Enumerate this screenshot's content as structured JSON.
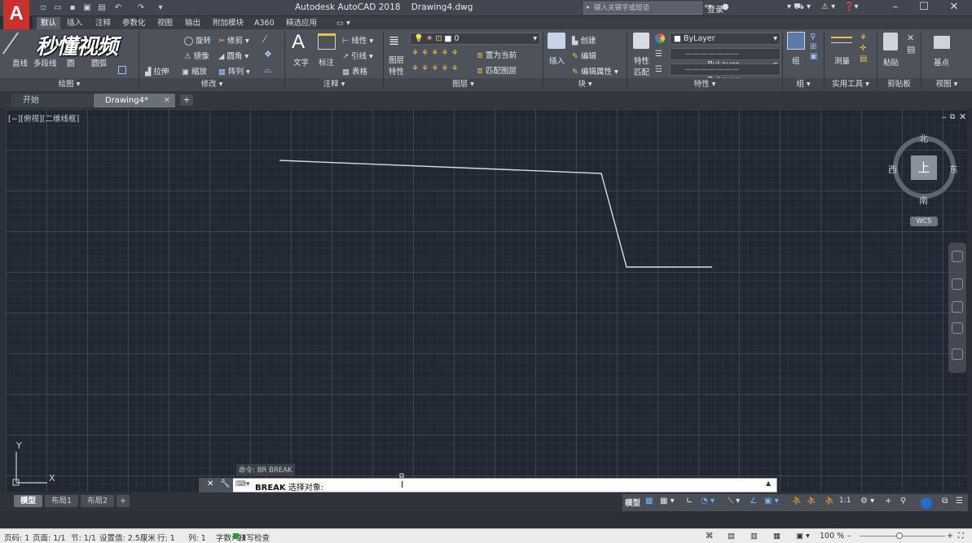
{
  "title": {
    "app": "Autodesk AutoCAD 2018",
    "doc": "Drawing4.dwg"
  },
  "search": {
    "placeholder": "键入关键字或短语"
  },
  "signin": "登录",
  "menu_tabs": [
    "默认",
    "插入",
    "注释",
    "参数化",
    "视图",
    "输出",
    "附加模块",
    "A360",
    "精选应用"
  ],
  "ribbon": {
    "draw": {
      "line": "直线",
      "polyline": "多段线",
      "circle": "圆",
      "arc": "圆弧"
    },
    "modify": {
      "rotate": "旋转",
      "trim": "修剪",
      "mirror": "镜像",
      "fillet": "圆角",
      "stretch": "拉伸",
      "scale": "缩放",
      "array": "阵列"
    },
    "annotation": {
      "text": "文字",
      "dimension": "标注",
      "linear": "线性",
      "leader": "引线",
      "table": "表格"
    },
    "layers": {
      "layer_props_1": "图层",
      "layer_props_2": "特性",
      "layer_value": "0",
      "set_current": "置为当前",
      "match_layer": "匹配图层"
    },
    "block": {
      "insert": "插入",
      "create": "创建",
      "edit": "编辑",
      "edit_attr": "编辑属性"
    },
    "properties": {
      "match_1": "特性",
      "match_2": "匹配",
      "color": "ByLayer",
      "linetype": "ByLayer",
      "lineweight": "ByLayer"
    },
    "groups": {
      "group": "组"
    },
    "utilities": {
      "measure": "测量"
    },
    "clipboard": {
      "paste": "粘贴"
    },
    "view": {
      "base": "基点"
    }
  },
  "panels": [
    "绘图 ▾",
    "修改 ▾",
    "注释 ▾",
    "图层 ▾",
    "块 ▾",
    "特性 ▾",
    "组 ▾",
    "实用工具 ▾",
    "剪贴板",
    "视图 ▾"
  ],
  "doc_tabs": [
    "开始",
    "Drawing4*"
  ],
  "viewport": {
    "label": "[−][俯视][二维线框]",
    "ucs_x": "X",
    "ucs_y": "Y"
  },
  "viewcube": {
    "north": "北",
    "south": "南",
    "east": "东",
    "west": "西",
    "top": "上",
    "wcs": "WCS"
  },
  "command": {
    "history": "命令: BR BREAK",
    "name": "BREAK",
    "prompt": "选择对象:"
  },
  "layout_tabs": [
    "模型",
    "布局1",
    "布局2"
  ],
  "status": {
    "model": "模型",
    "scale": "1:1"
  },
  "wordbar": {
    "page": "页码: 1",
    "pages": "页面: 1/1",
    "section": "节: 1/1",
    "setting": "设置值: 2.5厘米",
    "row": "行: 1",
    "col": "列: 1",
    "words": "字数: 91",
    "spell": "拼写检查",
    "zoom": "100 %"
  },
  "watermark": "秒懂视频",
  "colors": {
    "accent": "#c8312c",
    "canvas": "#212834"
  }
}
